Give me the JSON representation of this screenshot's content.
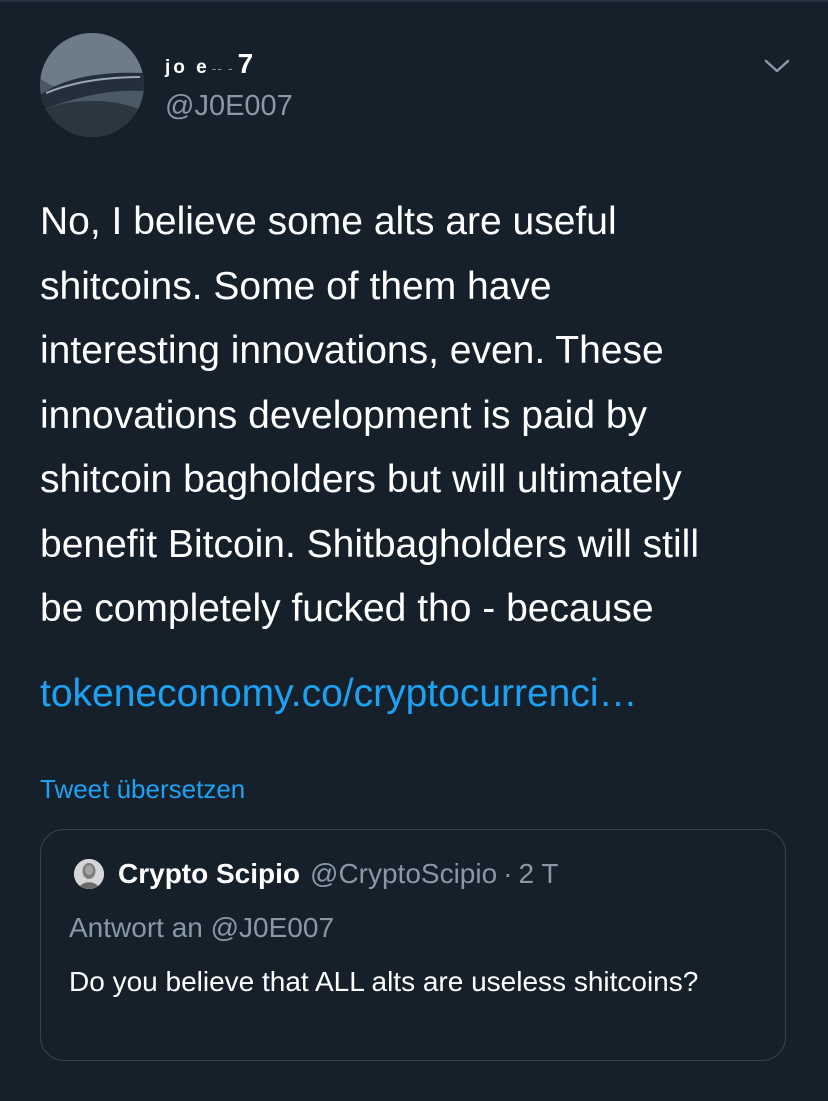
{
  "tweet": {
    "author": {
      "display_name_prefix": "jo e",
      "display_name_dash": "-- -",
      "display_name_suffix": "7",
      "handle": "@J0E007",
      "avatar_icon": "whale-avatar-icon"
    },
    "more_menu_icon": "chevron-down-icon",
    "text_lines": [
      "No, I believe some alts are useful",
      "shitcoins. Some of them have",
      "interesting innovations, even. These",
      "innovations development is paid by",
      "shitcoin bagholders but will ultimately",
      "benefit Bitcoin. Shitbagholders will still",
      "be completely fucked tho - because"
    ],
    "link": "tokeneconomy.co/cryptocurrenci…",
    "translate_label": "Tweet übersetzen"
  },
  "quoted_tweet": {
    "display_name": "Crypto Scipio",
    "handle": "@CryptoScipio",
    "separator": "·",
    "time": "2 T",
    "reply_to": "Antwort an @J0E007",
    "text": "Do you believe that ALL alts are useless shitcoins?",
    "avatar_icon": "bust-avatar-icon"
  },
  "colors": {
    "background": "#15202b",
    "text": "#ffffff",
    "secondary": "#8899a6",
    "accent": "#1da1f2",
    "border": "#38444d"
  }
}
